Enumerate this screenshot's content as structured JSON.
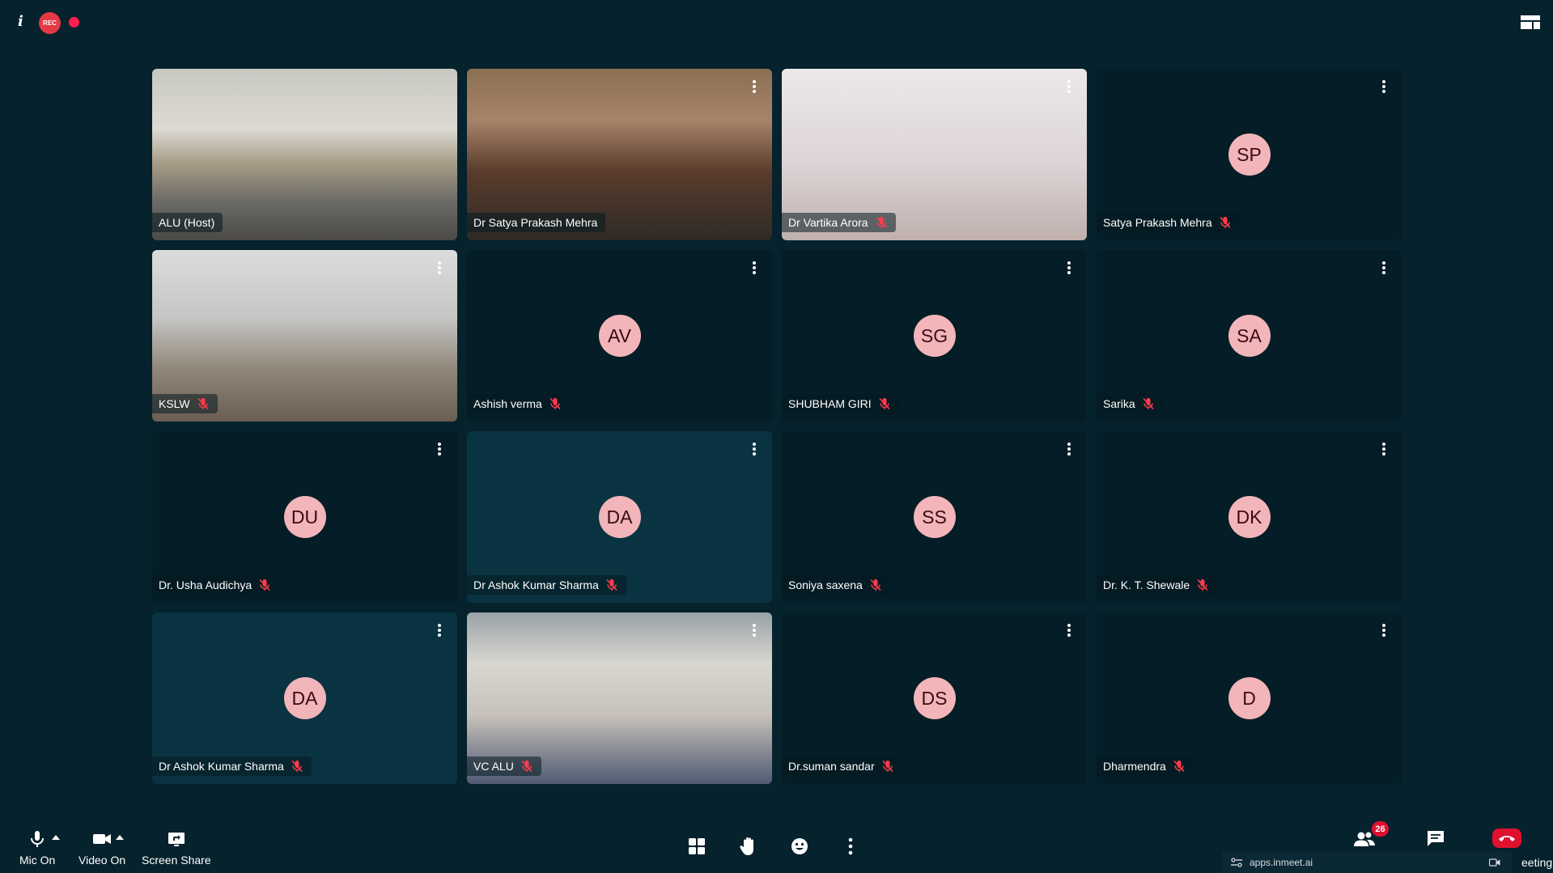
{
  "topbar": {
    "info_icon": "i",
    "rec_label": "REC",
    "recording_dot_color": "#ff1f4e",
    "layout_icon": "grid-layout-icon"
  },
  "participants": [
    {
      "name": "ALU (Host)",
      "initials": "",
      "video": "classroom",
      "muted": false,
      "menu": false
    },
    {
      "name": "Dr Satya Prakash Mehra",
      "initials": "",
      "video": "hat",
      "muted": false,
      "menu": true
    },
    {
      "name": "Dr Vartika Arora",
      "initials": "",
      "video": "woman1",
      "muted": true,
      "menu": true
    },
    {
      "name": "Satya Prakash Mehra",
      "initials": "SP",
      "video": "",
      "muted": true,
      "menu": true
    },
    {
      "name": "KSLW",
      "initials": "",
      "video": "hall",
      "muted": true,
      "menu": true
    },
    {
      "name": "Ashish verma",
      "initials": "AV",
      "video": "",
      "muted": true,
      "menu": true
    },
    {
      "name": "SHUBHAM GIRI",
      "initials": "SG",
      "video": "",
      "muted": true,
      "menu": true
    },
    {
      "name": "Sarika",
      "initials": "SA",
      "video": "",
      "muted": true,
      "menu": true
    },
    {
      "name": "Dr. Usha Audichya",
      "initials": "DU",
      "video": "",
      "muted": true,
      "menu": true
    },
    {
      "name": "Dr Ashok Kumar Sharma",
      "initials": "DA",
      "video": "",
      "muted": true,
      "menu": true,
      "alt": true
    },
    {
      "name": "Soniya saxena",
      "initials": "SS",
      "video": "",
      "muted": true,
      "menu": true
    },
    {
      "name": "Dr. K. T. Shewale",
      "initials": "DK",
      "video": "",
      "muted": true,
      "menu": true
    },
    {
      "name": "Dr Ashok Kumar Sharma",
      "initials": "DA",
      "video": "",
      "muted": true,
      "menu": true,
      "alt": true
    },
    {
      "name": "VC ALU",
      "initials": "",
      "video": "vc",
      "muted": true,
      "menu": true
    },
    {
      "name": "Dr.suman sandar",
      "initials": "DS",
      "video": "",
      "muted": true,
      "menu": true
    },
    {
      "name": "Dharmendra",
      "initials": "D",
      "video": "",
      "muted": true,
      "menu": true
    }
  ],
  "toolbar": {
    "mic_label": "Mic On",
    "video_label": "Video On",
    "screen_share_label": "Screen Share",
    "participants_count": "26",
    "end_label": "eeting",
    "url": "apps.inmeet.ai"
  },
  "colors": {
    "background": "#05222d",
    "tile": "#051d26",
    "tile_alt": "#0a3342",
    "avatar": "#f2b5b9",
    "danger": "#e0102f"
  }
}
